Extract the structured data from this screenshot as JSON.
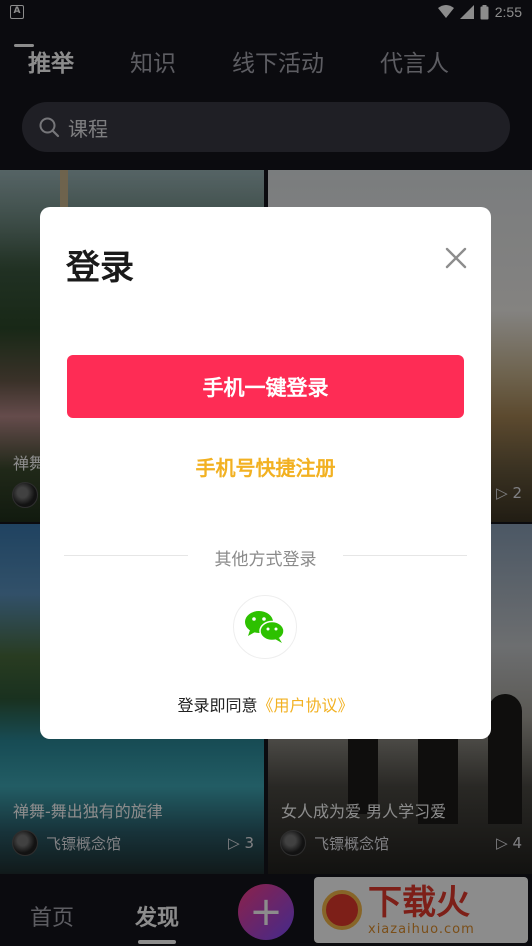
{
  "status_bar": {
    "time": "2:55"
  },
  "tabs": [
    {
      "label": "推举"
    },
    {
      "label": "知识"
    },
    {
      "label": "线下活动"
    },
    {
      "label": "代言人"
    }
  ],
  "search": {
    "text": "课程"
  },
  "cards": [
    {
      "title": "禅舞",
      "author": "",
      "count": ""
    },
    {
      "title": "",
      "author": "",
      "count": "2"
    },
    {
      "title": "禅舞-舞出独有的旋律",
      "author": "飞镖概念馆",
      "count": "3"
    },
    {
      "title": "女人成为爱 男人学习爱",
      "author": "飞镖概念馆",
      "count": "4"
    }
  ],
  "dialog": {
    "title": "登录",
    "primary_button": "手机一键登录",
    "register_link": "手机号快捷注册",
    "other_methods": "其他方式登录",
    "agree_prefix": "登录即同意",
    "agree_link": "《用户协议》"
  },
  "bottom_nav": {
    "home": "首页",
    "discover": "发现",
    "plus": "+"
  },
  "watermark": {
    "main": "下载火",
    "sub": "xiazaihuo.com"
  },
  "colors": {
    "accent": "#fe2c55",
    "link": "#f2b122",
    "background": "#14141c"
  }
}
